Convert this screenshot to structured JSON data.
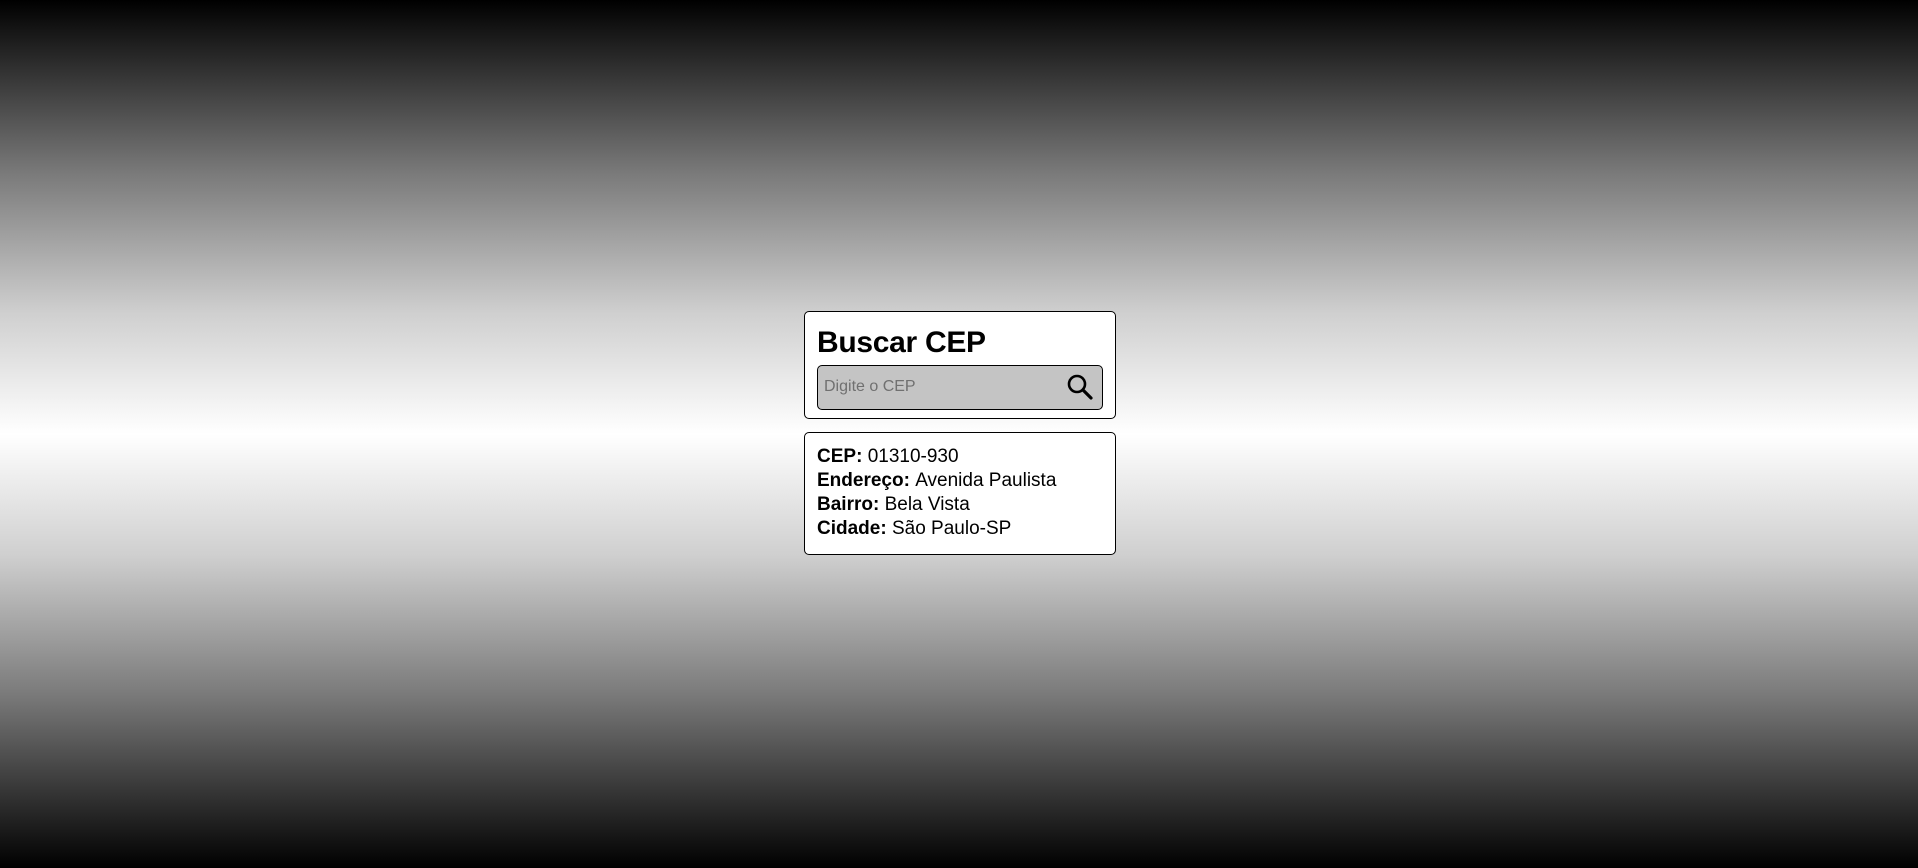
{
  "search": {
    "title": "Buscar CEP",
    "placeholder": "Digite o CEP",
    "value": "",
    "button_icon": "search-icon"
  },
  "result": {
    "cep_label": "CEP:",
    "cep_value": "01310-930",
    "endereco_label": "Endereço:",
    "endereco_value": "Avenida Paulista",
    "bairro_label": "Bairro:",
    "bairro_value": "Bela Vista",
    "cidade_label": "Cidade:",
    "cidade_value": "São Paulo-SP"
  },
  "colors": {
    "card_bg": "#ffffff",
    "input_bg": "#c4c4c4",
    "border": "#000000"
  }
}
